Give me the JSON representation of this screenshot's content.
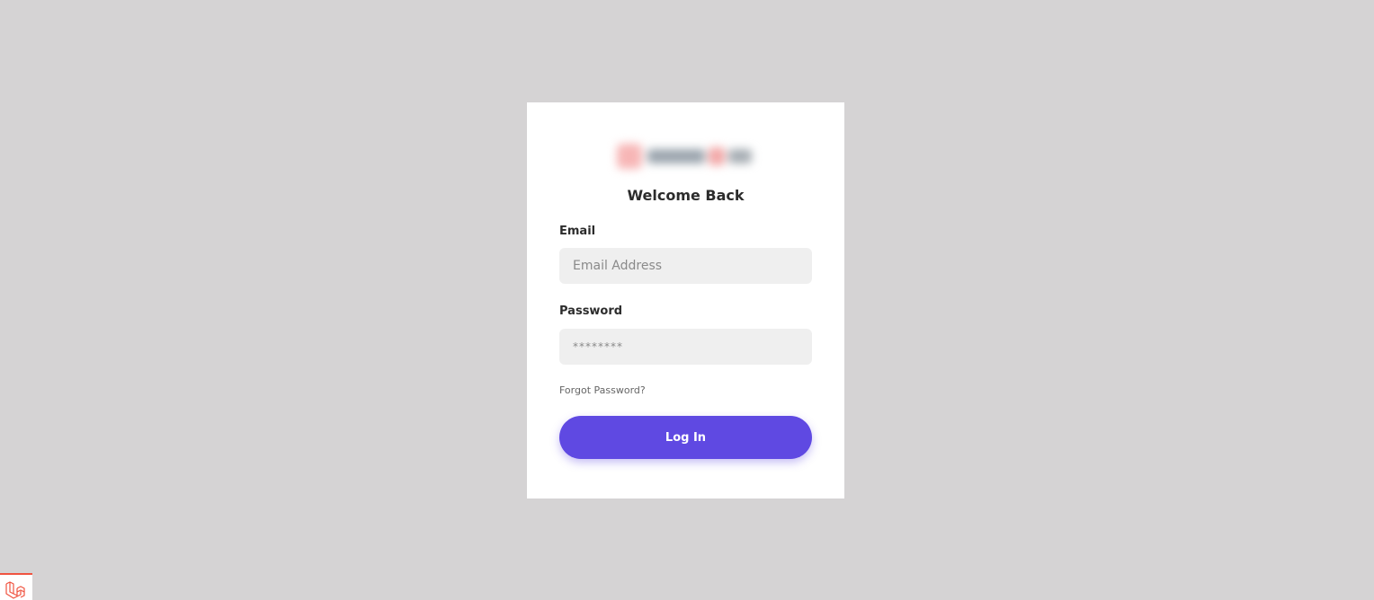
{
  "login": {
    "title": "Welcome Back",
    "email_label": "Email",
    "email_placeholder": "Email Address",
    "password_label": "Password",
    "password_placeholder": "********",
    "forgot_password": "Forgot Password?",
    "login_button": "Log In"
  },
  "logo": {
    "icon": "blurred-brand-logo"
  },
  "debug_badge": {
    "icon": "laravel-icon"
  },
  "colors": {
    "background": "#d5d3d4",
    "card": "#ffffff",
    "input_bg": "#efefef",
    "primary": "#5f49e2",
    "badge_accent": "#f05340"
  }
}
